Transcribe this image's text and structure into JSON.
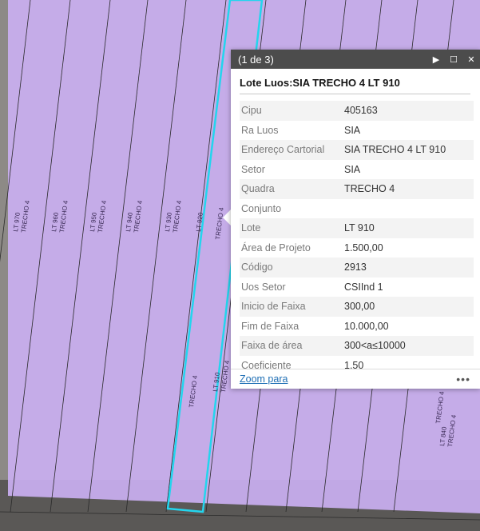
{
  "map": {
    "parcel_fill": "#c9aef0",
    "highlight_color": "#23d5ee",
    "line_color": "#2a2a2a",
    "parcel_labels": [
      {
        "lot": "LT 970",
        "street": "TRECHO 4"
      },
      {
        "lot": "LT 960",
        "street": "TRECHO 4"
      },
      {
        "lot": "LT 950",
        "street": "TRECHO 4"
      },
      {
        "lot": "LT 940",
        "street": "TRECHO 4"
      },
      {
        "lot": "LT 930",
        "street": "TRECHO 4"
      },
      {
        "lot": "LT 920",
        "street": ""
      },
      {
        "lot": "LT 910",
        "street": "TRECHO 4"
      },
      {
        "lot": "LT 840",
        "street": "TRECHO 4"
      }
    ],
    "big_labels": [
      "TRECHO 4",
      "TRECHO 4",
      "TRECHO 4"
    ]
  },
  "popup": {
    "counter": "(1 de 3)",
    "title": "Lote Luos:SIA TRECHO 4 LT 910",
    "attributes": [
      {
        "key": "Cipu",
        "value": "405163"
      },
      {
        "key": "Ra Luos",
        "value": "SIA"
      },
      {
        "key": "Endereço Cartorial",
        "value": "SIA TRECHO 4 LT 910"
      },
      {
        "key": "Setor",
        "value": "SIA"
      },
      {
        "key": "Quadra",
        "value": "TRECHO 4"
      },
      {
        "key": "Conjunto",
        "value": ""
      },
      {
        "key": "Lote",
        "value": "LT 910"
      },
      {
        "key": "Área de Projeto",
        "value": "1.500,00"
      },
      {
        "key": "Código",
        "value": "2913"
      },
      {
        "key": "Uos Setor",
        "value": "CSIInd 1"
      },
      {
        "key": "Inicio de Faixa",
        "value": "300,00"
      },
      {
        "key": "Fim de Faixa",
        "value": "10.000,00"
      },
      {
        "key": "Faixa de área",
        "value": "300<a≤10000"
      },
      {
        "key": "Coeficiente",
        "value": "1,50"
      }
    ],
    "footer": {
      "zoom_label": "Zoom para",
      "more_label": "•••"
    },
    "icons": {
      "next": "play-icon",
      "maximize": "maximize-icon",
      "close": "close-icon"
    }
  }
}
